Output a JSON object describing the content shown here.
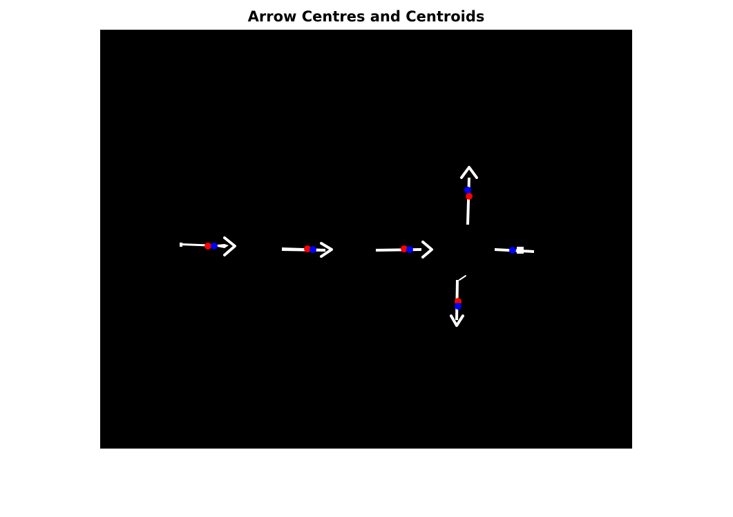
{
  "figure": {
    "title": "Arrow Centres and Centroids",
    "background_color": "#000000",
    "arrow_color": "#ffffff",
    "centre_marker_color": "#ff0000",
    "centroid_marker_color": "#0000ff"
  },
  "arrows": [
    {
      "id": "arrow-1",
      "direction": "right"
    },
    {
      "id": "arrow-2",
      "direction": "right"
    },
    {
      "id": "arrow-3",
      "direction": "right"
    },
    {
      "id": "arrow-4",
      "direction": "up"
    },
    {
      "id": "arrow-5",
      "direction": "right"
    },
    {
      "id": "arrow-6",
      "direction": "down"
    }
  ]
}
